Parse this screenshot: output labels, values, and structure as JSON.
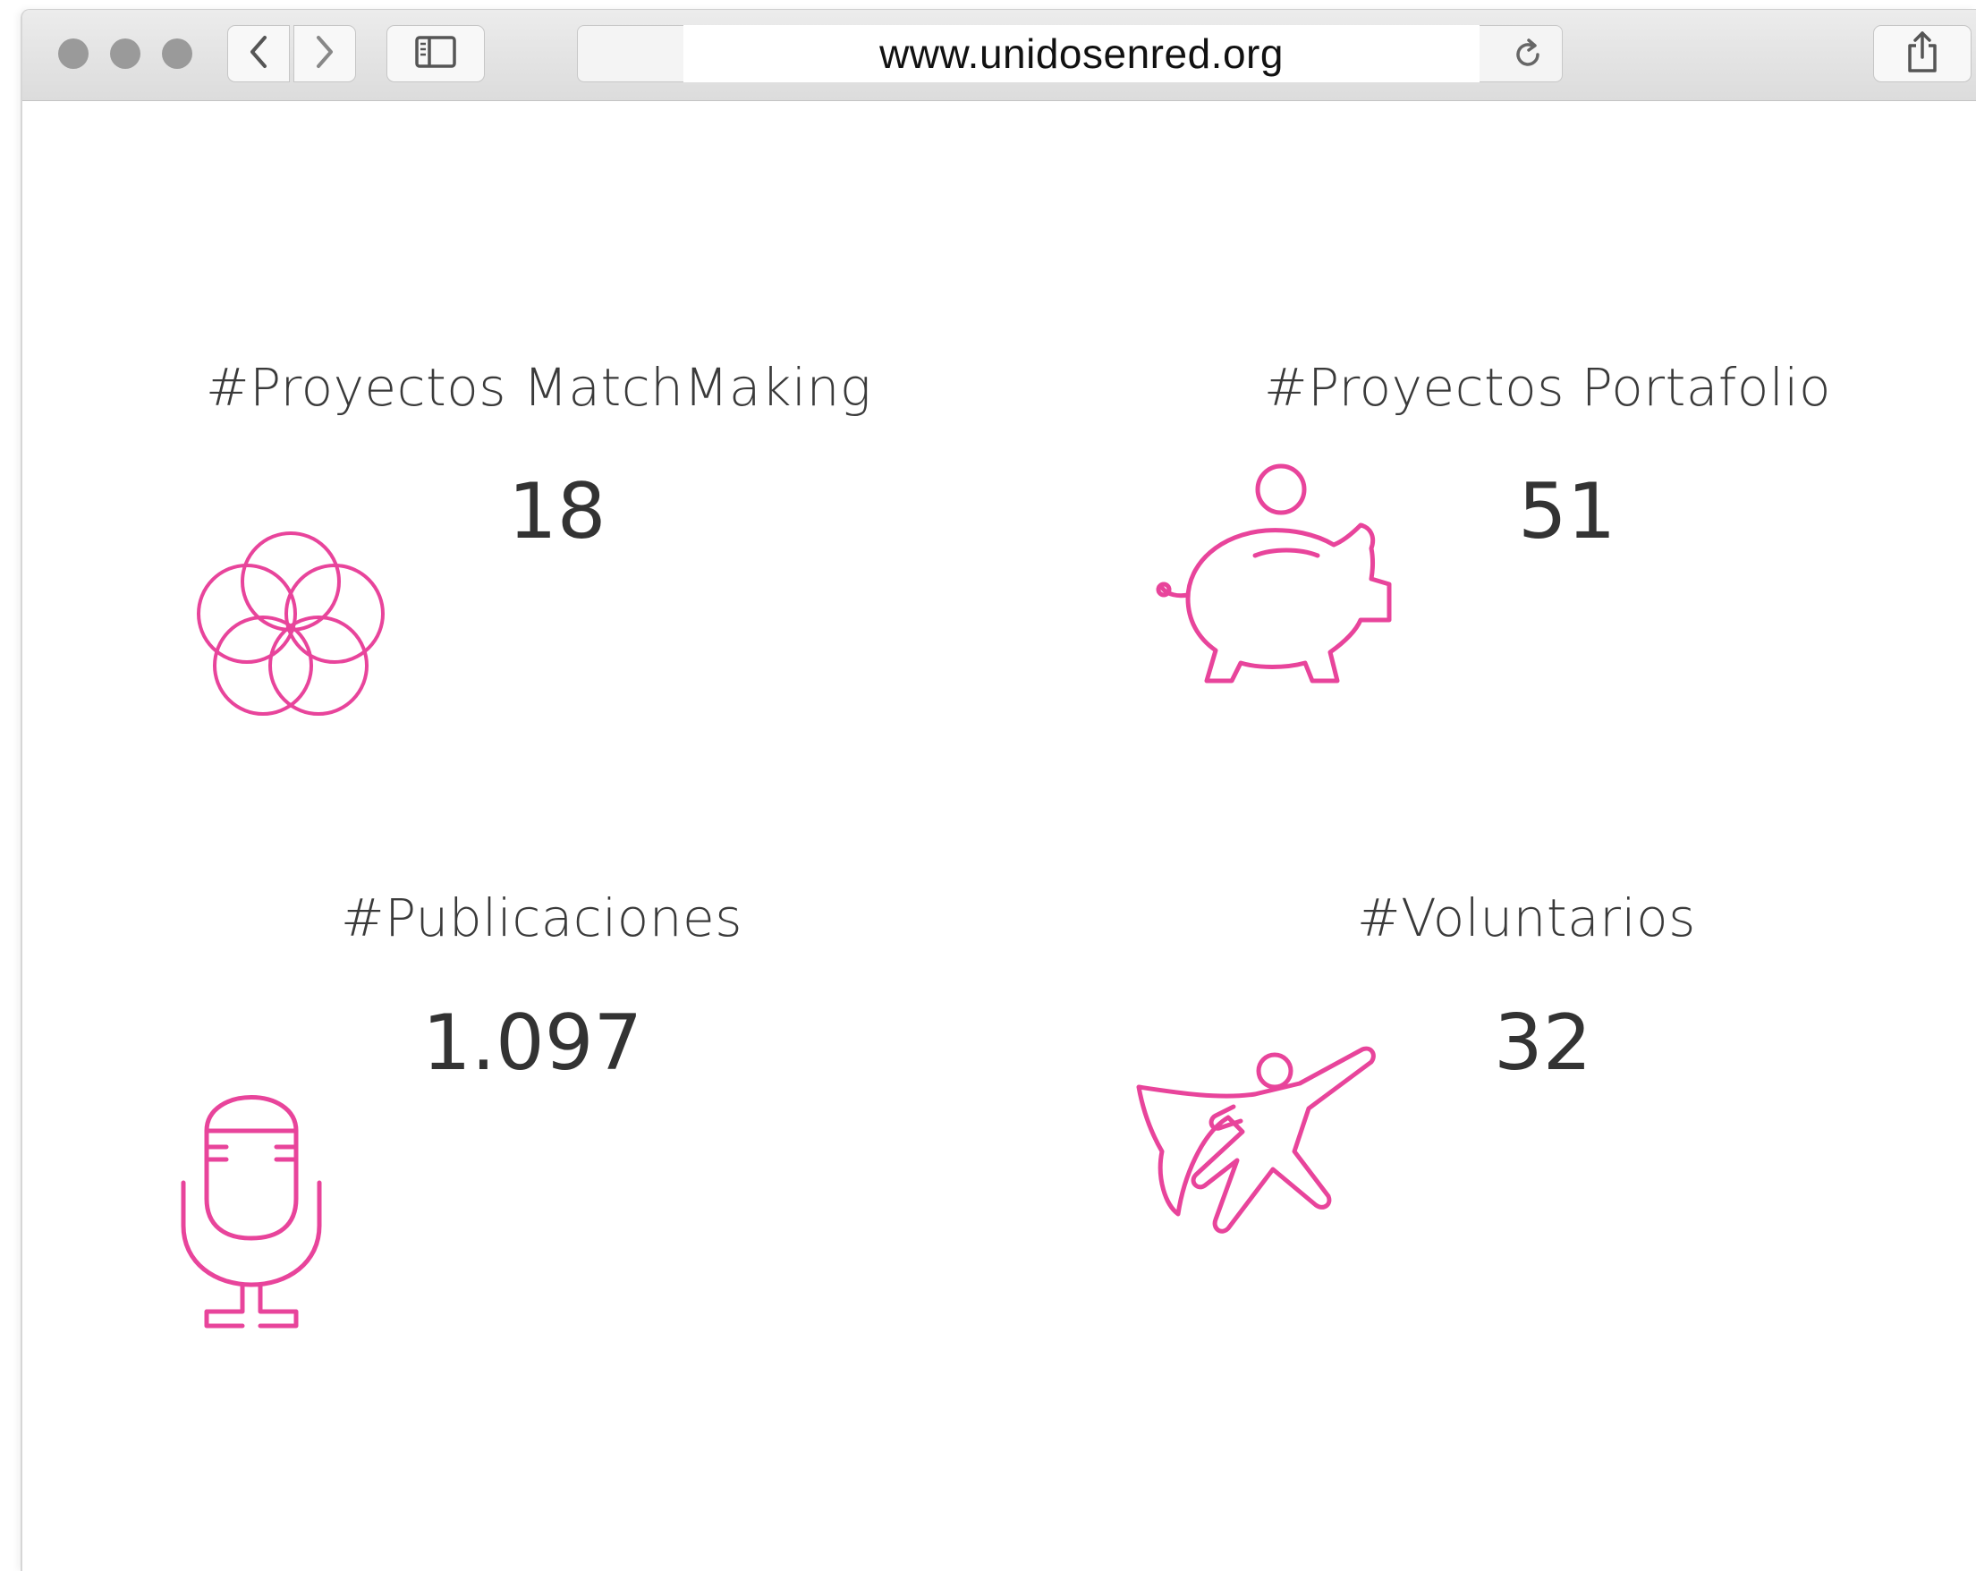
{
  "browser": {
    "url": "www.unidosenred.org"
  },
  "accent_color": "#e8449b",
  "stats": [
    {
      "label": "#Proyectos MatchMaking",
      "value": "18",
      "icon": "flower-of-life-icon"
    },
    {
      "label": "#Proyectos Portafolio",
      "value": "51",
      "icon": "piggy-bank-icon"
    },
    {
      "label": "#Publicaciones",
      "value": "1.097",
      "icon": "microphone-icon"
    },
    {
      "label": "#Voluntarios",
      "value": "32",
      "icon": "superhero-icon"
    }
  ]
}
